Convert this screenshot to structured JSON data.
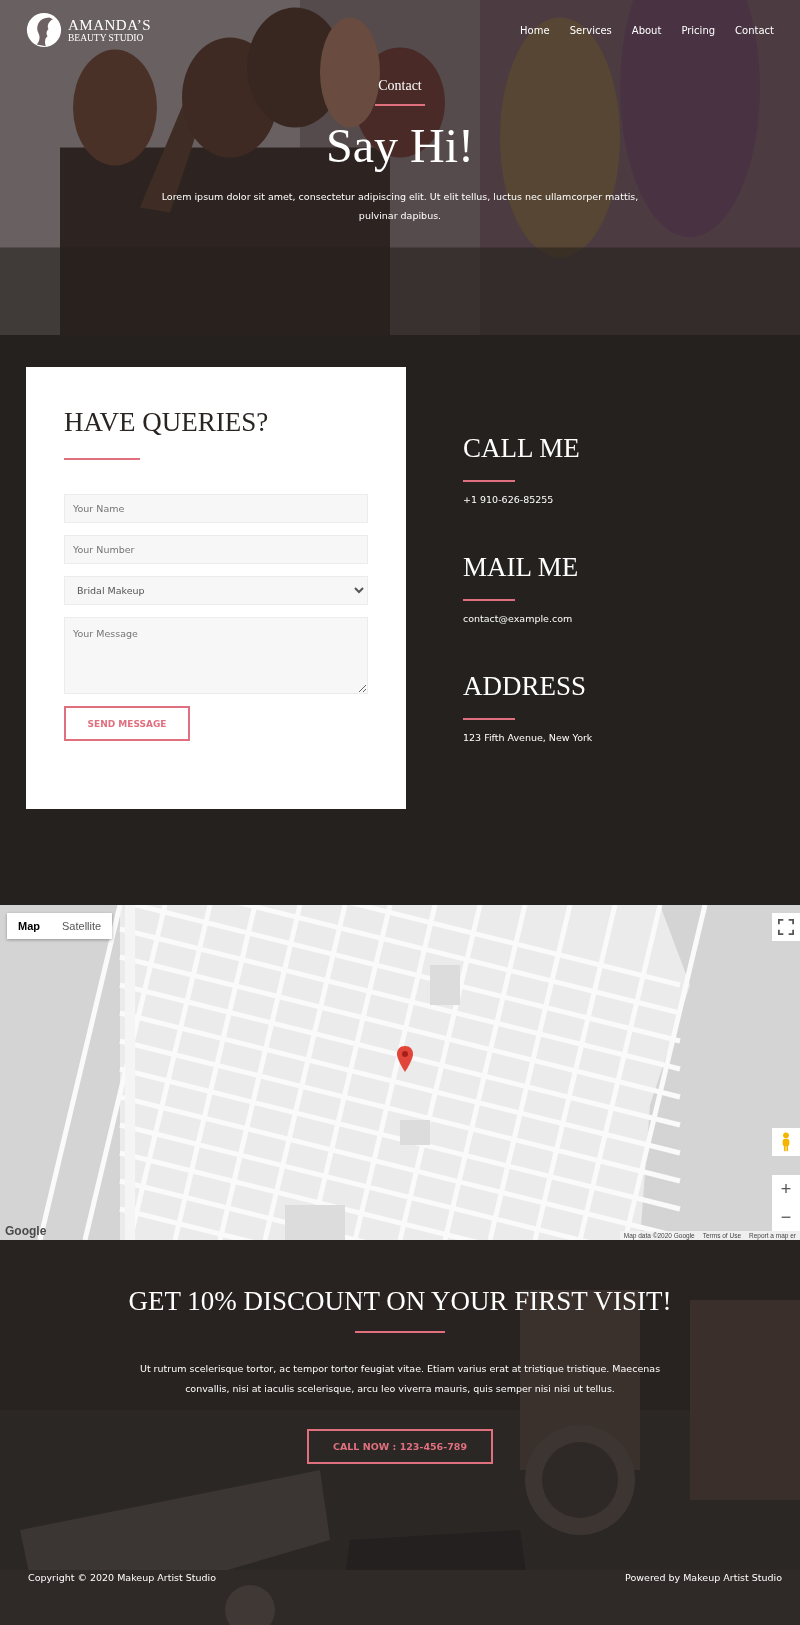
{
  "header": {
    "logo": {
      "line1": "AMANDA’S",
      "line2": "BEAUTY STUDIO"
    },
    "nav": [
      "Home",
      "Services",
      "About",
      "Pricing",
      "Contact"
    ]
  },
  "hero": {
    "kicker": "Contact",
    "title": "Say Hi!",
    "text": "Lorem ipsum dolor sit amet, consectetur adipiscing elit. Ut elit tellus, luctus nec ullamcorper mattis, pulvinar dapibus."
  },
  "form": {
    "title": "HAVE QUERIES?",
    "fields": [
      {
        "kind": "input",
        "placeholder": "Your Name"
      },
      {
        "kind": "input",
        "placeholder": "Your Number"
      },
      {
        "kind": "select",
        "value": "Bridal Makeup"
      },
      {
        "kind": "textarea",
        "placeholder": "Your Message"
      }
    ],
    "button": "SEND MESSAGE"
  },
  "contacts": [
    {
      "heading": "CALL ME",
      "text": "+1 910-626-85255"
    },
    {
      "heading": "MAIL ME",
      "text": "contact@example.com"
    },
    {
      "heading": "ADDRESS",
      "text": "123 Fifth Avenue, New York"
    }
  ],
  "map": {
    "tabs": [
      {
        "label": "Map",
        "selected": true
      },
      {
        "label": "Satellite",
        "selected": false
      }
    ],
    "zoom_in": "+",
    "zoom_out": "−",
    "logo": "Google",
    "attribution": [
      "Map data ©2020 Google",
      "Terms of Use",
      "Report a map er"
    ]
  },
  "promo": {
    "title": "GET 10% DISCOUNT ON YOUR FIRST VISIT!",
    "text": "Ut rutrum scelerisque tortor, ac tempor tortor feugiat vitae. Etiam varius erat at tristique tristique. Maecenas convallis, nisi at iaculis scelerisque, arcu leo viverra mauris, quis semper nisi nisi ut tellus.",
    "button": "CALL NOW : 123-456-789"
  },
  "footer": {
    "left": "Copyright © 2020 Makeup Artist Studio",
    "right": "Powered by Makeup Artist Studio"
  }
}
